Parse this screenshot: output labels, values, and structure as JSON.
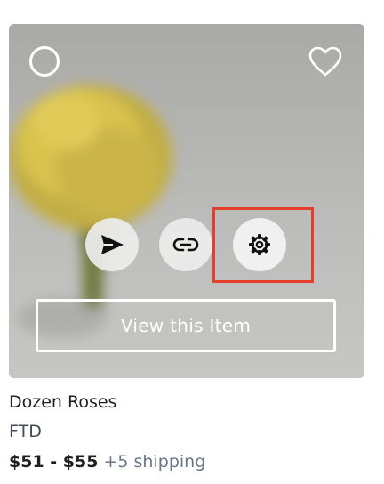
{
  "product": {
    "title": "Dozen Roses",
    "brand": "FTD",
    "price": "$51 - $55",
    "shipping": "+5 shipping"
  },
  "overlay": {
    "view_button_label": "View this Item",
    "actions": [
      {
        "name": "send",
        "icon": "send-icon"
      },
      {
        "name": "link",
        "icon": "link-icon"
      },
      {
        "name": "settings",
        "icon": "gear-icon"
      }
    ],
    "highlighted_action": "settings",
    "highlight_color": "#e53e2b"
  },
  "icons": {
    "select": "circle-select-icon",
    "favorite": "heart-outline-icon"
  },
  "colors": {
    "overlay_text": "#ffffff",
    "shipping_text": "#6a7688"
  }
}
